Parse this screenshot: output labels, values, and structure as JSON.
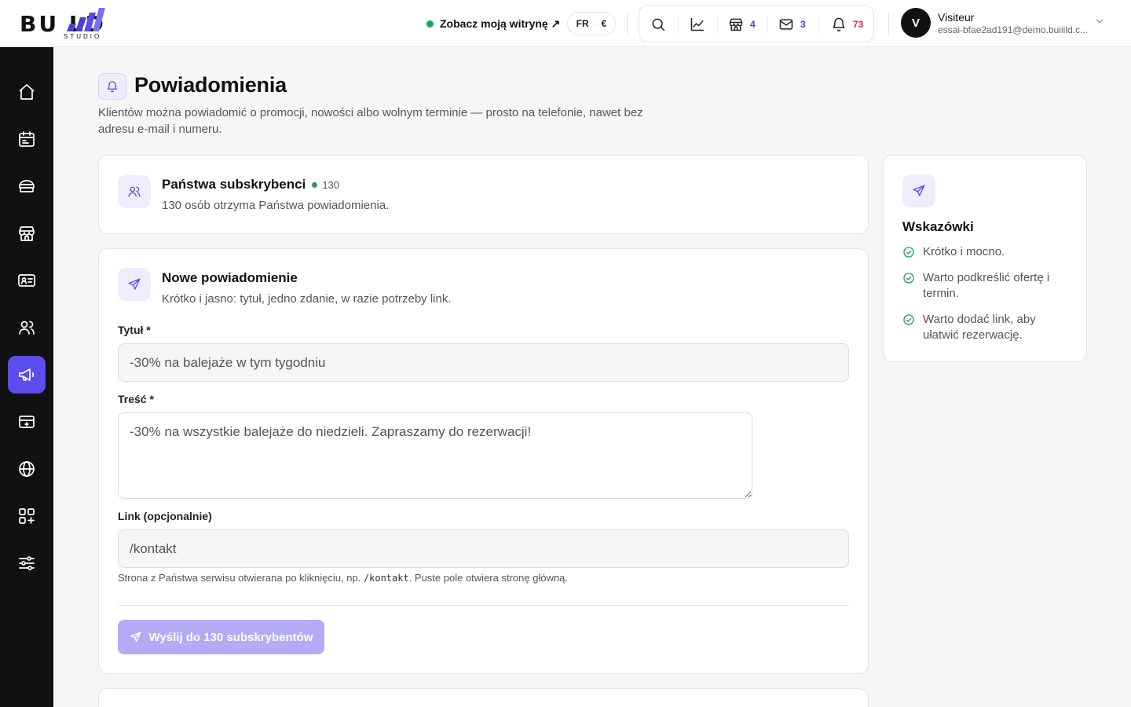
{
  "header": {
    "logo_text": "BU    LD",
    "logo_sub": "STUDIO",
    "site_link": "Zobacz moją witrynę ↗",
    "lang": "FR",
    "lang_sep": "·",
    "currency": "€",
    "tools": {
      "shop_count": "4",
      "mail_count": "3",
      "bell_count": "73"
    },
    "user": {
      "initial": "V",
      "name": "Visiteur",
      "email": "essai-bfae2ad191@demo.buiiild.c..."
    }
  },
  "sidebar": {
    "items": [
      {
        "icon": "home-icon"
      },
      {
        "icon": "calendar-icon"
      },
      {
        "icon": "services-icon"
      },
      {
        "icon": "store-icon"
      },
      {
        "icon": "contact-card-icon"
      },
      {
        "icon": "users-icon"
      },
      {
        "icon": "megaphone-icon",
        "active": true
      },
      {
        "icon": "payment-icon"
      },
      {
        "icon": "globe-icon"
      },
      {
        "icon": "apps-icon"
      },
      {
        "icon": "settings-sliders-icon"
      }
    ]
  },
  "page": {
    "title": "Powiadomienia",
    "description": "Klientów można powiadomić o promocji, nowości albo wolnym terminie — prosto na telefonie, nawet bez adresu e-mail i numeru."
  },
  "subscribers": {
    "title": "Państwa subskrybenci",
    "count": "130",
    "description": "130 osób otrzyma Państwa powiadomienia."
  },
  "form": {
    "title": "Nowe powiadomienie",
    "description": "Krótko i jasno: tytuł, jedno zdanie, w razie potrzeby link.",
    "title_label": "Tytuł *",
    "title_value": "-30% na balejaże w tym tygodniu",
    "body_label": "Treść *",
    "body_value": "-30% na wszystkie balejaże do niedzieli. Zapraszamy do rezerwacji!",
    "link_label": "Link (opcjonalnie)",
    "link_value": "/kontakt",
    "hint_before": "Strona z Państwa serwisu otwierana po kliknięciu, np. ",
    "hint_code": "/kontakt",
    "hint_after": ". Puste pole otwiera stronę główną.",
    "send_label": "Wyślij do 130 subskrybentów"
  },
  "tips": {
    "title": "Wskazówki",
    "items": [
      "Krótko i mocno.",
      "Warto podkreślić ofertę i termin.",
      "Warto dodać link, aby ułatwić rezerwację."
    ]
  },
  "colors": {
    "accent": "#5b4dee",
    "accent_light": "#efedfd",
    "sidebar_bg": "#111113",
    "status_green": "#1fa05a",
    "notification_red": "#e0283c"
  }
}
